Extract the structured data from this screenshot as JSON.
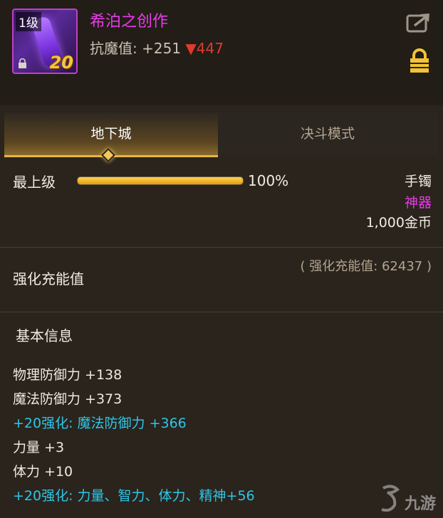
{
  "item": {
    "level_tag": "1级",
    "enhancement_level": "20",
    "name": "希泊之创作",
    "resist_label": "抗魔值:",
    "resist_value": "+251",
    "resist_diff": "▼447",
    "name_color": "#e83ce8"
  },
  "icons": {
    "share": "share-icon",
    "lock": "lock-icon"
  },
  "tabs": [
    {
      "label": "地下城",
      "active": true
    },
    {
      "label": "决斗模式",
      "active": false
    }
  ],
  "grade": {
    "label": "最上级",
    "progress_fraction": 1.0,
    "progress_text": "100%"
  },
  "meta": {
    "type": "手镯",
    "rarity": "神器",
    "price": "1,000金币",
    "rarity_color": "#e83ce8"
  },
  "amplify": {
    "label": "强化充能值",
    "value_text": "( 强化充能值: 62437 )"
  },
  "basic_info": {
    "title": "基本信息",
    "stats": [
      {
        "text": "物理防御力 +138",
        "style": "white"
      },
      {
        "text": "魔法防御力 +373",
        "style": "white"
      },
      {
        "text": "+20强化: 魔法防御力 +366",
        "style": "cyan"
      },
      {
        "text": "力量 +3",
        "style": "white"
      },
      {
        "text": "体力 +10",
        "style": "white"
      },
      {
        "text": "+20强化: 力量、智力、体力、精神+56",
        "style": "cyan"
      }
    ]
  },
  "watermark": {
    "text": "九游"
  },
  "colors": {
    "accent_gold": "#e7b544",
    "stat_cyan": "#2ec6e8",
    "diff_red": "#e03a2c"
  }
}
